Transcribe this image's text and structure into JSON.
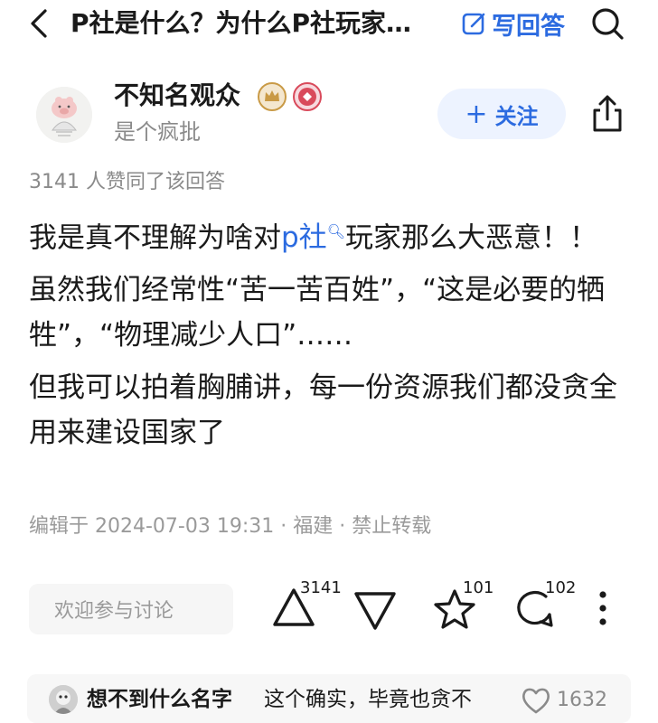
{
  "header": {
    "title": "P社是什么？为什么P社玩家…",
    "write_answer_label": "写回答"
  },
  "author": {
    "name": "不知名观众",
    "bio": "是个疯批",
    "follow_label": "关注"
  },
  "answer": {
    "approval_text": "3141 人赞同了该回答",
    "p1_before": "我是真不理解为啥对",
    "p1_link": "p社",
    "p1_after": "玩家那么大恶意！！",
    "p2": "虽然我们经常性“苦一苦百姓”，“这是必要的牺牲”，“物理减少人口”……",
    "p3": "但我可以拍着胸脯讲，每一份资源我们都没贪全用来建设国家了",
    "meta": "编辑于 2024-07-03 19:31 · 福建 · 禁止转载"
  },
  "actions": {
    "comment_placeholder": "欢迎参与讨论",
    "upvote_count": "3141",
    "favorite_count": "101",
    "comment_count": "102"
  },
  "comment_preview": {
    "name": "想不到什么名字",
    "text": "这个确实，毕竟也贪不",
    "likes": "1632"
  },
  "colors": {
    "accent": "#2c6be0",
    "follow_bg": "#edf3ff",
    "muted": "#8a8a8a",
    "badge_gold": "#c99a46",
    "badge_red": "#d94a5b"
  },
  "icons": [
    "back-icon",
    "edit-icon",
    "search-icon",
    "crown-badge-icon",
    "vip-badge-icon",
    "share-icon",
    "upvote-icon",
    "downvote-icon",
    "star-icon",
    "comment-icon",
    "more-icon",
    "heart-icon"
  ]
}
